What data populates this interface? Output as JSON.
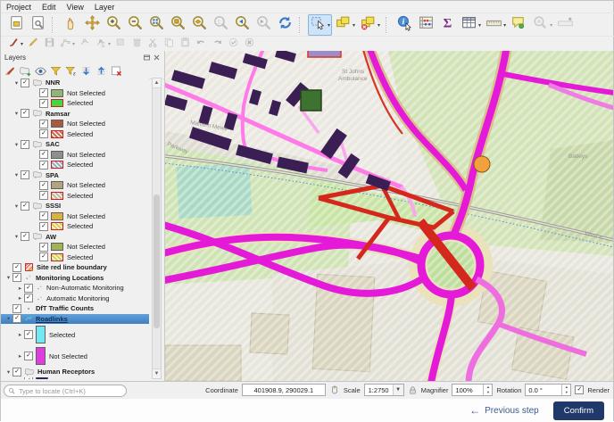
{
  "menu_bar": {
    "items": [
      "Project",
      "Edit",
      "View",
      "Layer"
    ]
  },
  "toolbar_main": [
    {
      "icon": "layout-new"
    },
    {
      "icon": "layout-manager"
    },
    {
      "sep": true
    },
    {
      "icon": "pan-hand"
    },
    {
      "icon": "pan-move"
    },
    {
      "icon": "zoom-in"
    },
    {
      "icon": "zoom-out"
    },
    {
      "icon": "zoom-full"
    },
    {
      "icon": "zoom-selection"
    },
    {
      "icon": "zoom-layer"
    },
    {
      "icon": "zoom-native",
      "disabled": true
    },
    {
      "icon": "zoom-last"
    },
    {
      "icon": "zoom-next",
      "disabled": true
    },
    {
      "icon": "refresh"
    },
    {
      "sep": true
    },
    {
      "icon": "select-rectangle",
      "active": true,
      "dropdown": true
    },
    {
      "icon": "select-features",
      "dropdown": true
    },
    {
      "icon": "deselect-features",
      "dropdown": true
    },
    {
      "sep": true
    },
    {
      "icon": "identify"
    },
    {
      "icon": "statistics"
    },
    {
      "icon": "sum"
    },
    {
      "icon": "attribute-table",
      "dropdown": true
    },
    {
      "icon": "measure",
      "dropdown": true
    },
    {
      "icon": "map-tips"
    },
    {
      "icon": "search-settings",
      "disabled": true,
      "dropdown": true
    },
    {
      "icon": "measure-bearing",
      "disabled": true
    }
  ],
  "toolbar_digitize": [
    {
      "icon": "current-edits",
      "dropdown": true
    },
    {
      "icon": "toggle-editing"
    },
    {
      "icon": "save-edits",
      "disabled": true
    },
    {
      "icon": "digitize-line",
      "disabled": true,
      "dropdown": true
    },
    {
      "icon": "add-record",
      "disabled": true
    },
    {
      "icon": "vertex-tool",
      "disabled": true,
      "dropdown": true
    },
    {
      "icon": "modify-attributes",
      "disabled": true
    },
    {
      "icon": "delete-selected",
      "disabled": true
    },
    {
      "icon": "cut-features",
      "disabled": true
    },
    {
      "icon": "copy-features",
      "disabled": true
    },
    {
      "icon": "paste-features",
      "disabled": true
    },
    {
      "icon": "undo",
      "disabled": true
    },
    {
      "icon": "redo",
      "disabled": true
    },
    {
      "icon": "save-edits-check",
      "disabled": true
    },
    {
      "icon": "cancel-edits",
      "disabled": true
    }
  ],
  "layers_panel": {
    "title": "Layers",
    "header_icons": [
      "undock-icon",
      "close-icon"
    ],
    "toolbar_icons": [
      "layer-styling",
      "add-group",
      "map-themes",
      "filter-legend",
      "filter-expression",
      "expand-all",
      "collapse-all",
      "remove-layer"
    ],
    "tree": [
      {
        "kind": "group",
        "level": 1,
        "label": "NNR",
        "children": [
          {
            "label": "Not Selected",
            "fill": "#93b573"
          },
          {
            "label": "Selected",
            "fill": "#45d645",
            "selected_style": true
          }
        ]
      },
      {
        "kind": "group",
        "level": 1,
        "label": "Ramsar",
        "children": [
          {
            "label": "Not Selected",
            "fill": "#a85a3f"
          },
          {
            "label": "Selected",
            "fill": "#d06a50",
            "selected_style": true,
            "hatch": true
          }
        ]
      },
      {
        "kind": "group",
        "level": 1,
        "label": "SAC",
        "children": [
          {
            "label": "Not Selected",
            "fill": "#8f8f8f"
          },
          {
            "label": "Selected",
            "fill": "#9fa9bd",
            "selected_style": true,
            "hatch": true
          }
        ]
      },
      {
        "kind": "group",
        "level": 1,
        "label": "SPA",
        "children": [
          {
            "label": "Not Selected",
            "fill": "#b3a47e"
          },
          {
            "label": "Selected",
            "fill": "#c4b594",
            "selected_style": true,
            "hatch": true
          }
        ]
      },
      {
        "kind": "group",
        "level": 1,
        "label": "SSSI",
        "children": [
          {
            "label": "Not Selected",
            "fill": "#d9b341"
          },
          {
            "label": "Selected",
            "fill": "#e2c853",
            "selected_style": true,
            "hatch": true
          }
        ]
      },
      {
        "kind": "group",
        "level": 1,
        "label": "AW",
        "children": [
          {
            "label": "Not Selected",
            "fill": "#a3b254"
          },
          {
            "label": "Selected",
            "fill": "#cbd74e",
            "selected_style": true,
            "hatch": true
          }
        ]
      },
      {
        "kind": "layer",
        "level": 0,
        "label": "Site red line boundary",
        "icon": "red-hatch",
        "bold": true
      },
      {
        "kind": "group",
        "level": 0,
        "label": "Monitoring Locations",
        "icon": "dots",
        "children": [
          {
            "label": "Non-Automatic Monitoring",
            "icon": "dots",
            "expander": true
          },
          {
            "label": "Automatic Monitoring",
            "icon": "dots",
            "expander": true
          }
        ]
      },
      {
        "kind": "layer",
        "level": 0,
        "label": "DfT Traffic Counts",
        "icon": "dot",
        "bold": true
      },
      {
        "kind": "group",
        "level": 0,
        "label": "Roadlinks",
        "selected_row": true,
        "icon": "line",
        "children": [
          {
            "label": "Selected",
            "fill": "#72e8f5",
            "tall": true,
            "expander": true
          },
          {
            "label": "Not Selected",
            "fill": "#dd3edd",
            "tall": true,
            "expander": true
          }
        ]
      },
      {
        "kind": "group",
        "level": 0,
        "label": "Human Receptors",
        "children": [
          {
            "label": "",
            "fill": "#3b1e53",
            "partial": true
          }
        ]
      }
    ]
  },
  "locate_bar": {
    "placeholder": "Type to locate (Ctrl+K)"
  },
  "status_bar": {
    "coordinate_label": "Coordinate",
    "coordinate_value": "401908.9, 290029.1",
    "scale_label": "Scale",
    "scale_value": "1:2750",
    "magnifier_label": "Magnifier",
    "magnifier_value": "100%",
    "rotation_label": "Rotation",
    "rotation_value": "0.0 °",
    "render_label": "Render",
    "render_checked": true
  },
  "footer": {
    "back_arrow": "←",
    "previous_label": "Previous step",
    "confirm_label": "Confirm"
  },
  "map": {
    "labels": {
      "st_johns_line1": "St Johns",
      "st_johns_line2": "Ambulance",
      "batleys": "Batleys",
      "malvern_mews": "Malvern Mews",
      "parkway": "Parkway",
      "west_end": "West e"
    },
    "markers": [
      {
        "name": "orange-circle-marker",
        "color": "#f2a13d"
      },
      {
        "name": "green-square-marker",
        "color": "#3e7231"
      }
    ],
    "colors": {
      "selected_road": "#d5281c",
      "roadlink_magenta": "#e41ad8",
      "residential_pink": "#ff7ae8",
      "building_purple": "#3b1e53",
      "field_green": "#cfe3b4"
    }
  }
}
